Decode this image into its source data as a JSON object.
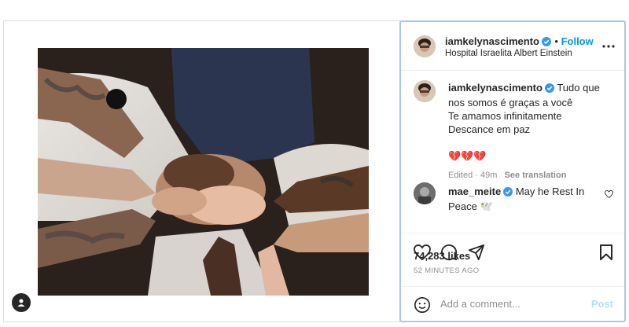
{
  "post": {
    "author": "iamkelynascimento",
    "follow_label": "Follow",
    "location": "Hospital Israelita Albert Einstein"
  },
  "caption": {
    "author": "iamkelynascimento",
    "line1": "Tudo que nos somos é graças a você",
    "line2": "Te amamos infinitamente",
    "line3": "Descance em paz",
    "emojis": "💔💔💔",
    "edited": "Edited",
    "age": "49m",
    "see_translation": "See translation"
  },
  "comment": {
    "author": "mae_meite",
    "text": "May he Rest In Peace 🕊️"
  },
  "likes": "74,283 likes",
  "timestamp": "52 MINUTES AGO",
  "composer": {
    "placeholder": "Add a comment...",
    "post_label": "Post"
  },
  "colors": {
    "accent": "#0095f6",
    "verified": "#3897f0",
    "heart": "#c8102e"
  }
}
